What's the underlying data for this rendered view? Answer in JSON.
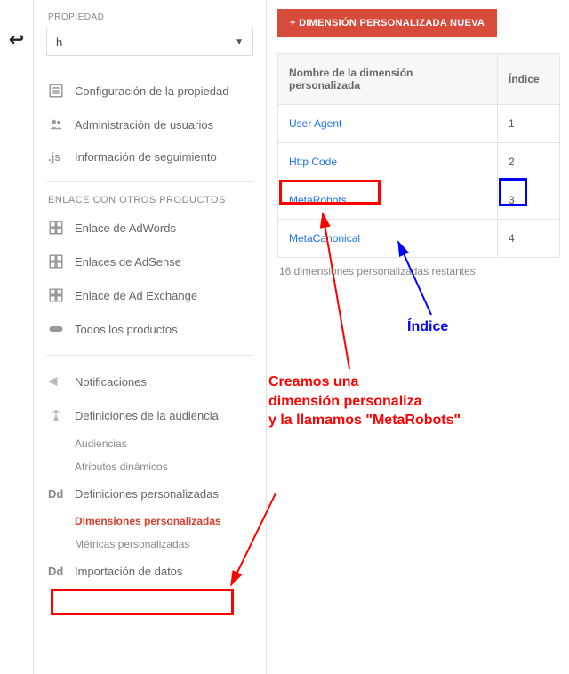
{
  "sidebar": {
    "section_label": "PROPIEDAD",
    "dropdown_value": "h",
    "items": {
      "config": "Configuración de la propiedad",
      "users": "Administración de usuarios",
      "tracking": "Información de seguimiento"
    },
    "link_section": "ENLACE CON OTROS PRODUCTOS",
    "links": {
      "adwords": "Enlace de AdWords",
      "adsense": "Enlaces de AdSense",
      "adexchange": "Enlace de Ad Exchange",
      "all": "Todos los productos"
    },
    "lower": {
      "notif": "Notificaciones",
      "audience_defs": "Definiciones de la audiencia",
      "audiences": "Audiencias",
      "dyn_attrs": "Atributos dinámicos",
      "custom_defs": "Definiciones personalizadas",
      "custom_dims": "Dimensiones personalizadas",
      "custom_metrics": "Métricas personalizadas",
      "data_import": "Importación de datos"
    }
  },
  "main": {
    "new_button": "+ DIMENSIÓN PERSONALIZADA NUEVA",
    "col_name": "Nombre de la dimensión personalizada",
    "col_index": "Índice",
    "rows": [
      {
        "name": "User Agent",
        "index": "1"
      },
      {
        "name": "Http Code",
        "index": "2"
      },
      {
        "name": "MetaRobots",
        "index": "3"
      },
      {
        "name": "MetaCanonical",
        "index": "4"
      }
    ],
    "remaining": "16 dimensiones personalizadas restantes"
  },
  "annotations": {
    "red_text": "Creamos una\ndimensión personaliza\ny la llamamos \"MetaRobots\"",
    "blue_text": "Índice"
  }
}
